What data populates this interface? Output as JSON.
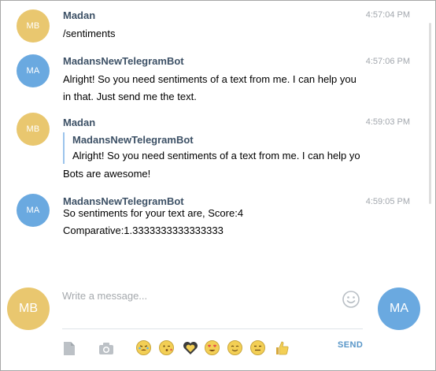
{
  "messages": [
    {
      "author": "Madan",
      "initials": "MB",
      "avatar_color": "#e9c76f",
      "time": "4:57:04 PM",
      "text": "/sentiments"
    },
    {
      "author": "MadansNewTelegramBot",
      "initials": "MA",
      "avatar_color": "#6aa9e0",
      "time": "4:57:06 PM",
      "text": "Alright! So you need sentiments of a text from me. I can help you in that. Just send me the text."
    },
    {
      "author": "Madan",
      "initials": "MB",
      "avatar_color": "#e9c76f",
      "time": "4:59:03 PM",
      "reply_author": "MadansNewTelegramBot",
      "reply_text": "Alright! So you need sentiments of a text from me. I can help yo",
      "text": "Bots are awesome!"
    },
    {
      "author": "MadansNewTelegramBot",
      "initials": "MA",
      "avatar_color": "#6aa9e0",
      "time": "4:59:05 PM",
      "text": "So sentiments for your text are, Score:4 Comparative:1.3333333333333333"
    }
  ],
  "composer": {
    "user_initials": "MB",
    "peer_initials": "MA",
    "placeholder": "Write a message...",
    "send_label": "SEND"
  },
  "toolbar_icons": [
    "attach-file-icon",
    "camera-icon",
    "crying-emoji-icon",
    "kiss-emoji-icon",
    "heart-emoji-icon",
    "heart-eyes-emoji-icon",
    "smile-emoji-icon",
    "neutral-emoji-icon",
    "thumbs-up-emoji-icon"
  ],
  "colors": {
    "author": "#3d5166",
    "time": "#a2a7ad",
    "send": "#5896c8",
    "reply_border": "#9cc4ec"
  }
}
